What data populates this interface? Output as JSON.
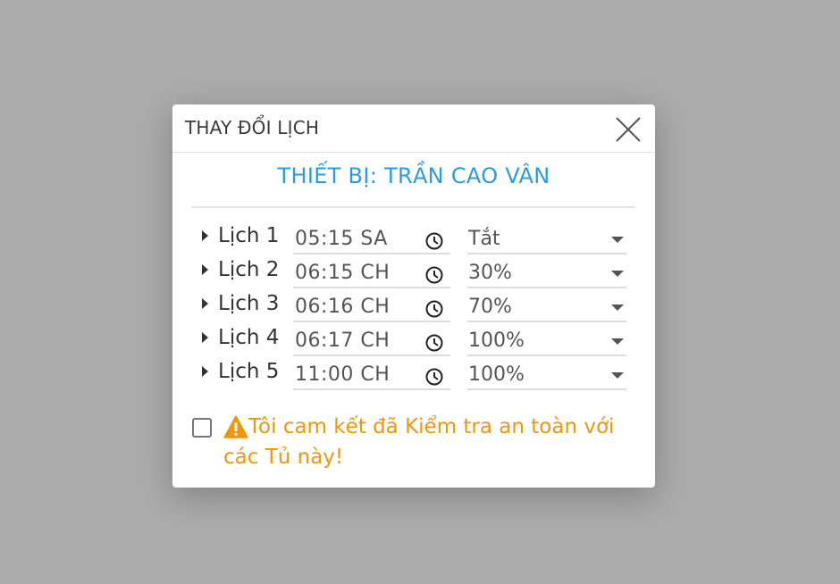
{
  "dialog": {
    "title": "THAY ĐỔI LỊCH",
    "device_title": "THIẾT BỊ: TRẦN CAO VÂN"
  },
  "icons": {
    "close": "close-icon",
    "clock": "clock-icon",
    "dropdown": "dropdown-icon",
    "caret": "caret-right-icon",
    "warning": "warning-icon"
  },
  "colors": {
    "accent": "#2a9be6",
    "warning": "#f0960c",
    "overlay": "#acacac"
  },
  "schedules": [
    {
      "label": "Lịch 1",
      "time": "05:15 SA",
      "level": "Tắt"
    },
    {
      "label": "Lịch 2",
      "time": "06:15 CH",
      "level": "30%"
    },
    {
      "label": "Lịch 3",
      "time": "06:16 CH",
      "level": "70%"
    },
    {
      "label": "Lịch 4",
      "time": "06:17 CH",
      "level": "100%"
    },
    {
      "label": "Lịch 5",
      "time": "11:00 CH",
      "level": "100%"
    }
  ],
  "confirm": {
    "checked": false,
    "text": "Tôi cam kết đã Kiểm tra an toàn với các Tủ này!"
  }
}
